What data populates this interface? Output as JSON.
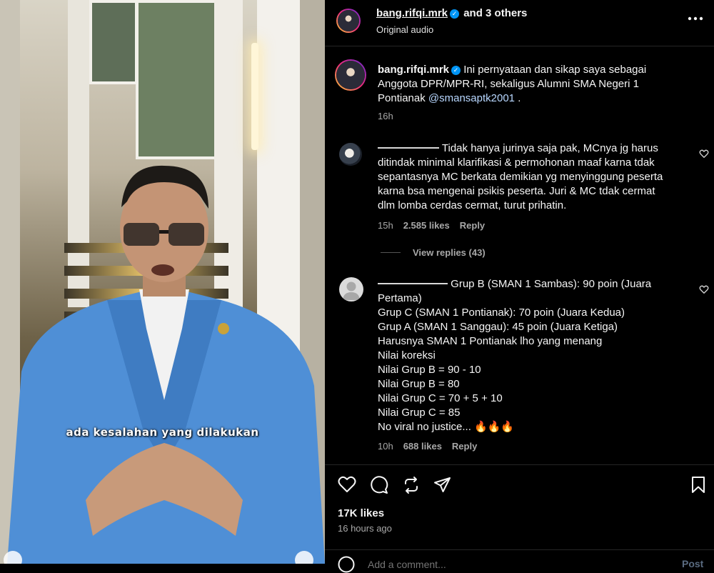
{
  "header": {
    "username": "bang.rifqi.mrk",
    "collab_text": "and 3 others",
    "audio": "Original audio",
    "more_icon": "more-horizontal-icon"
  },
  "video": {
    "caption": "ada kesalahan yang dilakukan"
  },
  "post": {
    "username": "bang.rifqi.mrk",
    "caption_text": "Ini pernyataan dan sikap saya sebagai Anggota DPR/MPR-RI, sekaligus Alumni SMA Negeri 1 Pontianak",
    "caption_line1": "Ini pernyataan dan sikap saya sebagai",
    "caption_line2": "Anggota DPR/MPR-RI, sekaligus Alumni SMA Negeri 1",
    "caption_line3": "Pontianak",
    "mention": "@smansaptk2001",
    "trailing": " .",
    "time": "16h"
  },
  "comments": [
    {
      "lines": [
        "Tidak hanya jurinya saja pak, MCnya jg harus",
        "ditindak minimal klarifikasi & permohonan maaf karna tdak",
        "sepantasnya MC berkata demikian yg menyinggung peserta",
        "karna bsa mengenai psikis peserta. Juri & MC tdak cermat",
        "dlm lomba cerdas cermat, turut prihatin."
      ],
      "time": "15h",
      "likes": "2.585 likes",
      "reply": "Reply",
      "view_replies": "View replies (43)"
    },
    {
      "lines": [
        "Grup B (SMAN 1 Sambas): 90 poin (Juara",
        "Pertama)",
        "Grup C (SMAN 1 Pontianak): 70 poin (Juara Kedua)",
        "Grup A (SMAN 1 Sanggau): 45 poin (Juara Ketiga)",
        "Harusnya SMAN 1 Pontianak lho yang menang",
        "Nilai koreksi",
        "Nilai Grup B = 90 - 10",
        "Nilai Grup B = 80",
        "Nilai Grup C = 70 + 5 + 10",
        "Nilai Grup C = 85",
        "No viral no justice... 🔥🔥🔥"
      ],
      "time": "10h",
      "likes": "688 likes",
      "reply": "Reply"
    }
  ],
  "actions": {
    "likes": "17K likes",
    "posted": "16 hours ago",
    "icons": [
      "heart-icon",
      "comment-icon",
      "repost-icon",
      "share-icon",
      "bookmark-icon"
    ]
  },
  "add_comment": {
    "placeholder": "Add a comment...",
    "post_label": "Post"
  },
  "colors": {
    "background": "#000000",
    "text": "#f5f5f5",
    "muted": "#a8a8a8",
    "verified": "#0095f6",
    "mention": "#b8d7ff"
  }
}
